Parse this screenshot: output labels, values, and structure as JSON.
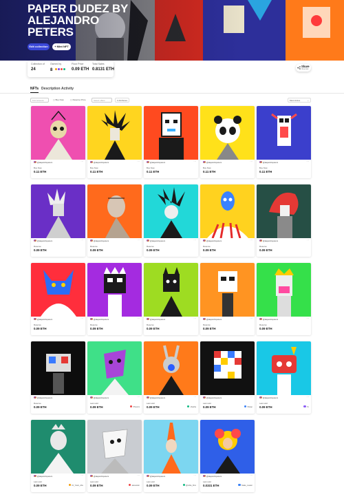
{
  "collection": {
    "title": "PAPER DUDEZ BY ALEJANDRO PETERS",
    "edit_label": "Edit collection",
    "mint_label": "Mint NFT"
  },
  "stats": {
    "collection_of_label": "Collection of",
    "collection_of_value": "24",
    "owned_by_label": "Owned by",
    "owned_by_value": "8",
    "floor_price_label": "Floor Price",
    "floor_price_value": "0.09 ETH",
    "total_sales_label": "Total Sales",
    "total_sales_value": "0.8131 ETH"
  },
  "share": {
    "label": "Share",
    "sub": "View link"
  },
  "tabs": [
    {
      "label": "NFTs",
      "active": true
    },
    {
      "label": "Description",
      "active": false
    },
    {
      "label": "Activity",
      "active": false
    }
  ],
  "filters": {
    "search_placeholder": "Find artwork",
    "buy_now": "Buy Now",
    "reserve_price": "Reserve Price",
    "auction_placeholder": "Select offers",
    "attributes": "Attributes",
    "sort": "Most Active"
  },
  "creator_handle": "@alejandropeters",
  "nfts": [
    {
      "status": "Buy Now",
      "price": "0.11 ETH",
      "buyer": "",
      "bg": "#ef4fb0"
    },
    {
      "status": "Buy Now",
      "price": "0.11 ETH",
      "buyer": "",
      "bg": "#ffd51f"
    },
    {
      "status": "Buy Now",
      "price": "0.11 ETH",
      "buyer": "",
      "bg": "#ff4a1f"
    },
    {
      "status": "Buy Now",
      "price": "0.11 ETH",
      "buyer": "",
      "bg": "#ffe11a"
    },
    {
      "status": "Buy Now",
      "price": "0.11 ETH",
      "buyer": "",
      "bg": "#3b3fcc"
    },
    {
      "status": "Reserve",
      "price": "0.09 ETH",
      "buyer": "",
      "bg": "#6a2fc6"
    },
    {
      "status": "Reserve",
      "price": "0.09 ETH",
      "buyer": "",
      "bg": "#ff6a1c"
    },
    {
      "status": "Reserve",
      "price": "0.09 ETH",
      "buyer": "",
      "bg": "#22d8d8"
    },
    {
      "status": "Reserve",
      "price": "0.09 ETH",
      "buyer": "",
      "bg": "#ffd21f"
    },
    {
      "status": "Reserve",
      "price": "0.09 ETH",
      "buyer": "",
      "bg": "#264f45"
    },
    {
      "status": "Reserve",
      "price": "0.09 ETH",
      "buyer": "",
      "bg": "#ff2e3c"
    },
    {
      "status": "Reserve",
      "price": "0.09 ETH",
      "buyer": "",
      "bg": "#a42be0"
    },
    {
      "status": "Reserve",
      "price": "0.09 ETH",
      "buyer": "",
      "bg": "#9edc22"
    },
    {
      "status": "Reserve",
      "price": "0.09 ETH",
      "buyer": "",
      "bg": "#ff9422"
    },
    {
      "status": "Reserve",
      "price": "0.09 ETH",
      "buyer": "",
      "bg": "#35e04a"
    },
    {
      "status": "Reserve",
      "price": "0.09 ETH",
      "buyer": "",
      "bg": "#0d0d0d"
    },
    {
      "status": "Last sold",
      "price": "0.09 ETH",
      "buyer": "Pheonix",
      "bg": "#3fe088"
    },
    {
      "status": "Last sold",
      "price": "0.09 ETH",
      "buyer": "shasha",
      "bg": "#ff7a1a"
    },
    {
      "status": "Last sold",
      "price": "0.09 ETH",
      "buyer": "Sheep",
      "bg": "#111111"
    },
    {
      "status": "Last sold",
      "price": "0.09 ETH",
      "buyer": "Yu",
      "bg": "#19c8e6"
    },
    {
      "status": "Last sold",
      "price": "0.09 ETH",
      "buyer": "Dr_Yasin_Abu",
      "bg": "#1f8c6e"
    },
    {
      "status": "Last sold",
      "price": "0.09 ETH",
      "buyer": "alexander",
      "bg": "#c9ccd1"
    },
    {
      "status": "Last sold",
      "price": "0.09 ETH",
      "buyer": "@ruble_bhm",
      "bg": "#7cd6f0"
    },
    {
      "status": "Last sold",
      "price": "0.0331 ETH",
      "buyer": "Stake_master",
      "bg": "#2f5fe8"
    }
  ],
  "colors": {
    "accent": "#3b48d8",
    "hero_bg": "#1b1f6e"
  }
}
